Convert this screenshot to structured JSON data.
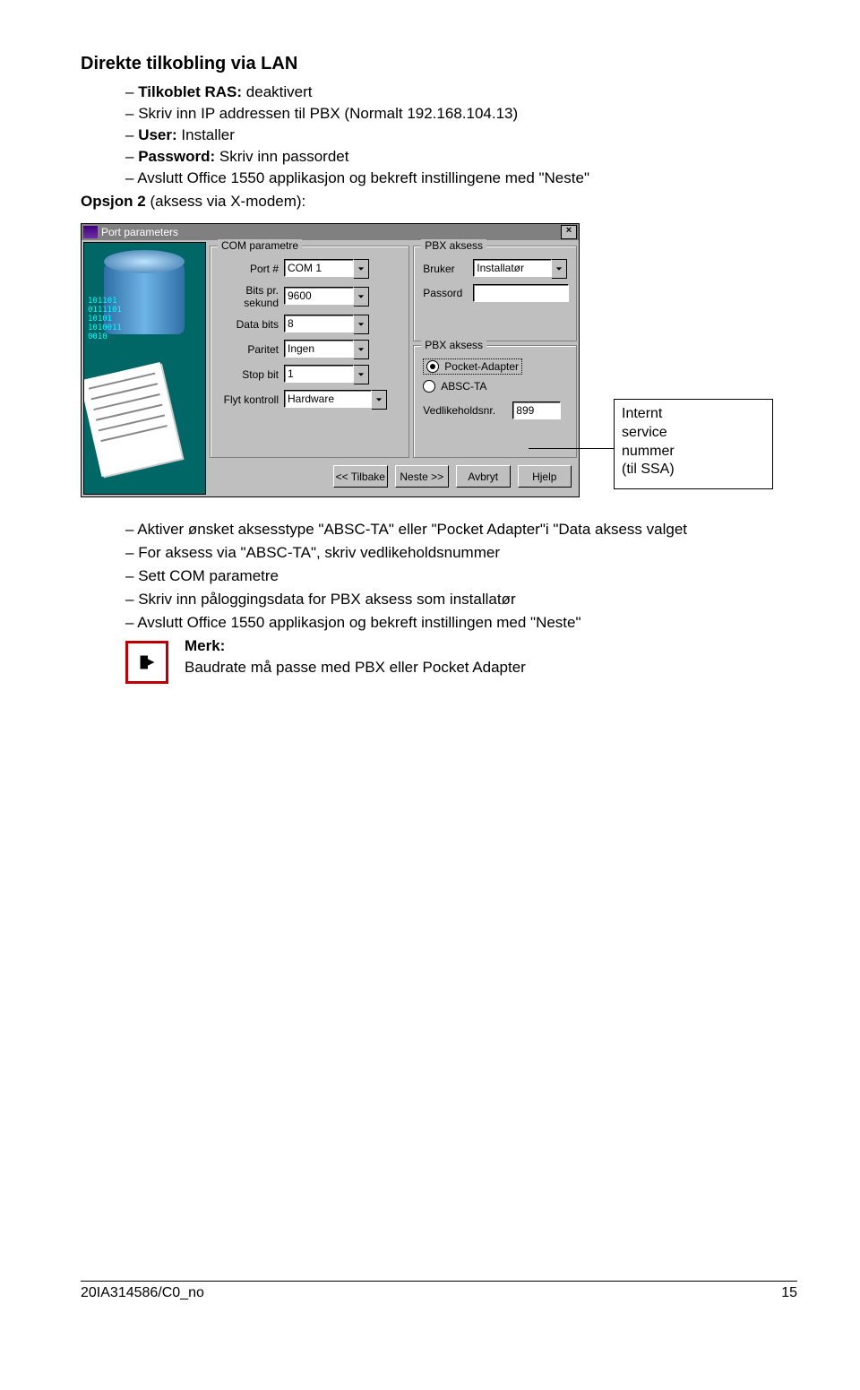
{
  "heading": "Direkte tilkobling via LAN",
  "bullets1": [
    {
      "prefix": "Tilkoblet RAS:",
      "text": "deaktivert",
      "prefix_bold": true
    },
    {
      "text": "Skriv inn IP addressen til PBX (Normalt 192.168.104.13)"
    },
    {
      "prefix": "User:",
      "text": "Installer",
      "prefix_bold": true
    },
    {
      "prefix": "Password:",
      "text": "Skriv inn passordet",
      "prefix_bold": true
    },
    {
      "text": "Avslutt Office 1550 applikasjon og bekreft instillingene med \"Neste\""
    }
  ],
  "option2": {
    "label": "Opsjon 2",
    "rest": " (aksess via X-modem):"
  },
  "dialog": {
    "title": "Port parameters",
    "group_com": "COM parametre",
    "group_pbx1": "PBX aksess",
    "group_pbx2": "PBX aksess",
    "com": {
      "port_label": "Port #",
      "port_value": "COM 1",
      "bits_label": "Bits pr. sekund",
      "bits_value": "9600",
      "databits_label": "Data bits",
      "databits_value": "8",
      "paritet_label": "Paritet",
      "paritet_value": "Ingen",
      "stopbit_label": "Stop bit",
      "stopbit_value": "1",
      "flyt_label": "Flyt kontroll",
      "flyt_value": "Hardware"
    },
    "pbx": {
      "bruker_label": "Bruker",
      "bruker_value": "Installatør",
      "passord_label": "Passord",
      "passord_value": "",
      "radio_pocket": "Pocket-Adapter",
      "radio_absc": "ABSC-TA",
      "vedl_label": "Vedlikeholdsnr.",
      "vedl_value": "899"
    },
    "buttons": {
      "back": "<< Tilbake",
      "next": "Neste >>",
      "cancel": "Avbryt",
      "help": "Hjelp"
    }
  },
  "callout": {
    "line1": "Internt",
    "line2": "service",
    "line3": "nummer",
    "line4": "(til SSA)"
  },
  "bullets2": [
    "Aktiver ønsket aksesstype \"ABSC-TA\" eller \"Pocket Adapter\"i \"Data aksess valget",
    "For aksess via \"ABSC-TA\", skriv vedlikeholdsnummer",
    "Sett COM parametre",
    "Skriv inn påloggingsdata for PBX aksess som installatør",
    "Avslutt Office 1550 applikasjon og bekreft instillingen med \"Neste\""
  ],
  "merk": {
    "label": "Merk:",
    "body": "Baudrate må passe med PBX eller Pocket Adapter"
  },
  "footer": {
    "doc": "20IA314586/C0_no",
    "page": "15"
  }
}
